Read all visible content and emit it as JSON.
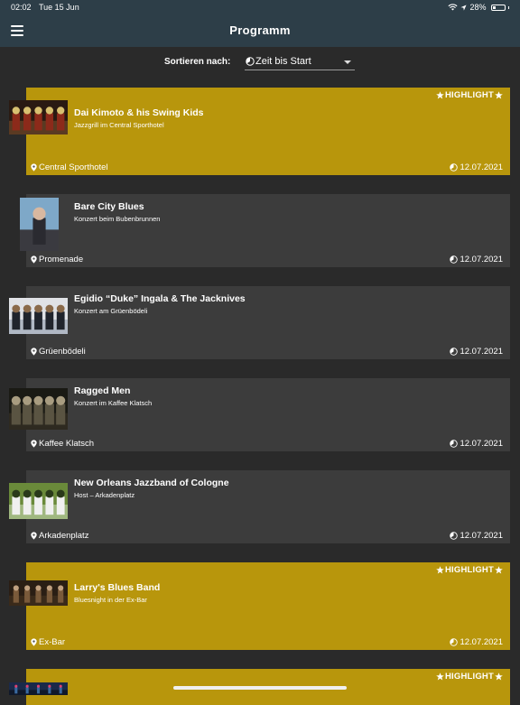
{
  "status": {
    "time": "02:02",
    "date": "Tue 15 Jun",
    "battery": "28%",
    "battery_level": 0.28
  },
  "appbar": {
    "title": "Programm"
  },
  "sort": {
    "label": "Sortieren nach:",
    "value": "Zeit bis Start"
  },
  "events": [
    {
      "name": "Dai Kimoto & his Swing Kids",
      "subtitle": "Jazzgrill im Central Sporthotel",
      "location": "Central Sporthotel",
      "date": "12.07.2021",
      "highlight": true,
      "badge": "HIGHLIGHT"
    },
    {
      "name": "Bare City Blues",
      "subtitle": "Konzert beim Bubenbrunnen",
      "location": "Promenade",
      "date": "12.07.2021",
      "highlight": false
    },
    {
      "name": "Egidio “Duke” Ingala & The Jacknives",
      "subtitle": "Konzert am Grüenbödeli",
      "location": "Grüenbödeli",
      "date": "12.07.2021",
      "highlight": false
    },
    {
      "name": "Ragged Men",
      "subtitle": "Konzert im Kaffee Klatsch",
      "location": "Kaffee Klatsch",
      "date": "12.07.2021",
      "highlight": false
    },
    {
      "name": "New Orleans Jazzband of Cologne",
      "subtitle": "Host – Arkadenplatz",
      "location": "Arkadenplatz",
      "date": "12.07.2021",
      "highlight": false
    },
    {
      "name": "Larry's Blues Band",
      "subtitle": "Bluesnight in der Ex-Bar",
      "location": "Ex-Bar",
      "date": "12.07.2021",
      "highlight": true,
      "badge": "HIGHLIGHT"
    },
    {
      "name": "",
      "subtitle": "",
      "location": "",
      "date": "",
      "highlight": true,
      "badge": "HIGHLIGHT"
    }
  ],
  "colors": {
    "appbar": "#2d3e48",
    "background": "#2a2a2a",
    "card": "#3c3c3c",
    "highlight": "#b8960c"
  },
  "icons": {
    "menu": "menu-icon",
    "clock": "clock-icon",
    "pin": "location-pin-icon",
    "star": "star-icon",
    "wifi": "wifi-icon",
    "location_arrow": "location-arrow-icon",
    "battery": "battery-icon"
  }
}
